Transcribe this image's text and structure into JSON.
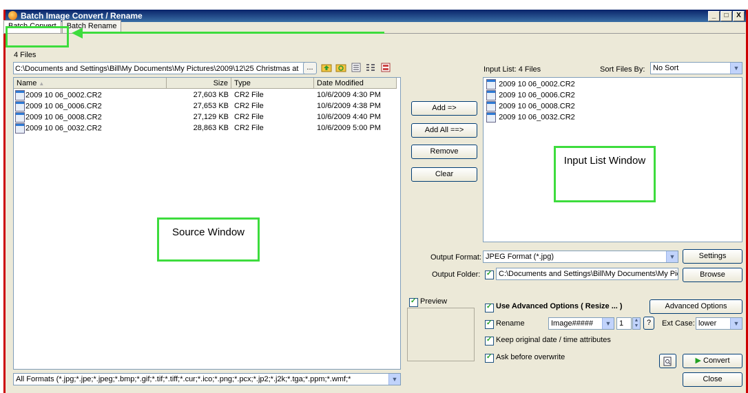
{
  "window": {
    "title": "Batch Image Convert / Rename",
    "controls": [
      "_",
      "□",
      "X"
    ]
  },
  "tabs": [
    {
      "label": "Batch Convert"
    },
    {
      "label": "Batch Rename"
    }
  ],
  "source": {
    "file_count": "4 Files",
    "path": "C:\\Documents and Settings\\Bill\\My Documents\\My Pictures\\2009\\12\\25 Christmas at",
    "browse_label": "...",
    "columns": {
      "name": "Name",
      "size": "Size",
      "type": "Type",
      "date": "Date Modified"
    },
    "files": [
      {
        "name": "2009 10 06_0002.CR2",
        "size": "27,603 KB",
        "type": "CR2 File",
        "date": "10/6/2009 4:30 PM"
      },
      {
        "name": "2009 10 06_0006.CR2",
        "size": "27,653 KB",
        "type": "CR2 File",
        "date": "10/6/2009 4:38 PM"
      },
      {
        "name": "2009 10 06_0008.CR2",
        "size": "27,129 KB",
        "type": "CR2 File",
        "date": "10/6/2009 4:40 PM"
      },
      {
        "name": "2009 10 06_0032.CR2",
        "size": "28,863 KB",
        "type": "CR2 File",
        "date": "10/6/2009 5:00 PM"
      }
    ],
    "filter": "All Formats (*.jpg;*.jpe;*.jpeg;*.bmp;*.gif;*.tif;*.tiff;*.cur;*.ico;*.png;*.pcx;*.jp2;*.j2k;*.tga;*.ppm;*.wmf;*"
  },
  "actions": {
    "add": "Add =>",
    "add_all": "Add All ==>",
    "remove": "Remove",
    "clear": "Clear"
  },
  "input_list": {
    "header": "Input List: 4 Files",
    "sort_label": "Sort Files By:",
    "sort_value": "No Sort",
    "files": [
      "2009 10 06_0002.CR2",
      "2009 10 06_0006.CR2",
      "2009 10 06_0008.CR2",
      "2009 10 06_0032.CR2"
    ]
  },
  "output": {
    "format_label": "Output Format:",
    "format_value": "JPEG Format (*.jpg)",
    "settings_label": "Settings",
    "folder_label": "Output Folder:",
    "folder_value": "C:\\Documents and Settings\\Bill\\My Documents\\My Pictu",
    "browse_label": "Browse"
  },
  "options": {
    "preview_label": "Preview",
    "use_advanced_label": "Use Advanced Options ( Resize ... )",
    "advanced_button": "Advanced Options",
    "rename_label": "Rename",
    "rename_pattern": "Image#####",
    "rename_start": "1",
    "help_label": "?",
    "ext_case_label": "Ext Case:",
    "ext_case_value": "lower",
    "keep_dates_label": "Keep original date / time attributes",
    "ask_overwrite_label": "Ask before overwrite",
    "convert_label": "Convert",
    "close_label": "Close"
  },
  "annotations": {
    "source_window": "Source Window",
    "input_list_window": "Input List Window"
  }
}
